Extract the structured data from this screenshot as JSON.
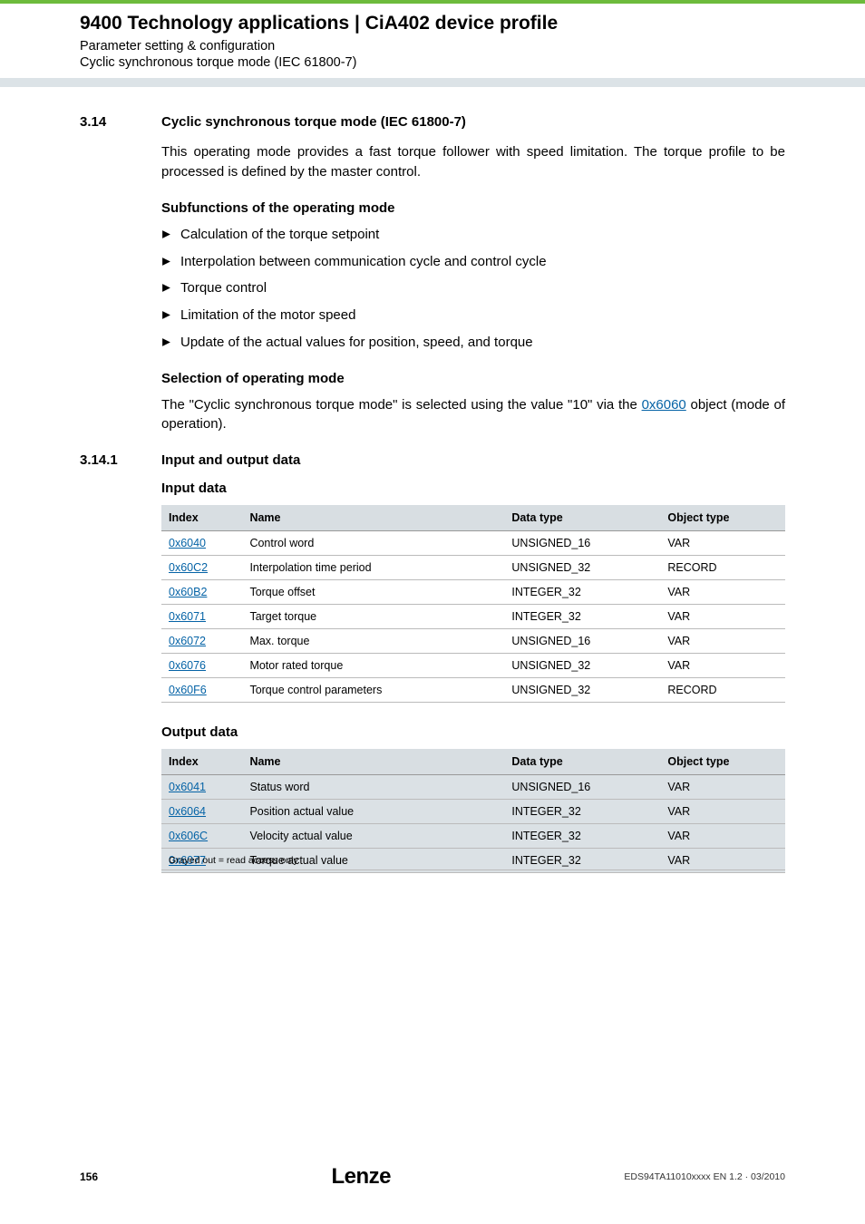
{
  "header": {
    "title": "9400 Technology applications | CiA402 device profile",
    "subtitle1": "Parameter setting & configuration",
    "subtitle2": "Cyclic synchronous torque mode (IEC 61800-7)"
  },
  "sec314": {
    "num": "3.14",
    "title": "Cyclic synchronous torque mode (IEC 61800-7)",
    "intro": "This operating mode provides a fast torque follower with speed limitation. The torque profile to be processed is defined by the master control.",
    "subfuncHead": "Subfunctions of the operating mode",
    "bullets": [
      "Calculation of the torque setpoint",
      "Interpolation between communication cycle and control cycle",
      "Torque control",
      "Limitation of the motor speed",
      "Update of the actual values for position, speed, and torque"
    ],
    "selHead": "Selection of operating mode",
    "selText1": "The \"Cyclic synchronous torque mode\" is selected using the value \"10\" via the ",
    "selLink": "0x6060",
    "selText2": " object (mode of operation)."
  },
  "sec3141": {
    "num": "3.14.1",
    "title": "Input and output data",
    "inputHead": "Input data",
    "outputHead": "Output data",
    "cols": {
      "c1": "Index",
      "c2": "Name",
      "c3": "Data type",
      "c4": "Object type"
    },
    "inputRows": [
      {
        "idx": "0x6040",
        "name": "Control word",
        "dt": "UNSIGNED_16",
        "ot": "VAR"
      },
      {
        "idx": "0x60C2",
        "name": "Interpolation time period",
        "dt": "UNSIGNED_32",
        "ot": "RECORD"
      },
      {
        "idx": "0x60B2",
        "name": "Torque offset",
        "dt": "INTEGER_32",
        "ot": "VAR"
      },
      {
        "idx": "0x6071",
        "name": "Target torque",
        "dt": "INTEGER_32",
        "ot": "VAR"
      },
      {
        "idx": "0x6072",
        "name": "Max. torque",
        "dt": "UNSIGNED_16",
        "ot": "VAR"
      },
      {
        "idx": "0x6076",
        "name": "Motor rated torque",
        "dt": "UNSIGNED_32",
        "ot": "VAR"
      },
      {
        "idx": "0x60F6",
        "name": "Torque control parameters",
        "dt": "UNSIGNED_32",
        "ot": "RECORD"
      }
    ],
    "outputRows": [
      {
        "idx": "0x6041",
        "name": "Status word",
        "dt": "UNSIGNED_16",
        "ot": "VAR"
      },
      {
        "idx": "0x6064",
        "name": "Position actual value",
        "dt": "INTEGER_32",
        "ot": "VAR"
      },
      {
        "idx": "0x606C",
        "name": "Velocity actual value",
        "dt": "INTEGER_32",
        "ot": "VAR"
      },
      {
        "idx": "0x6077",
        "name": "Torque actual value",
        "dt": "INTEGER_32",
        "ot": "VAR"
      }
    ],
    "footnote": "Grayed out = read access only"
  },
  "footer": {
    "page": "156",
    "logo": "Lenze",
    "docid": "EDS94TA11010xxxx EN 1.2 · 03/2010"
  }
}
